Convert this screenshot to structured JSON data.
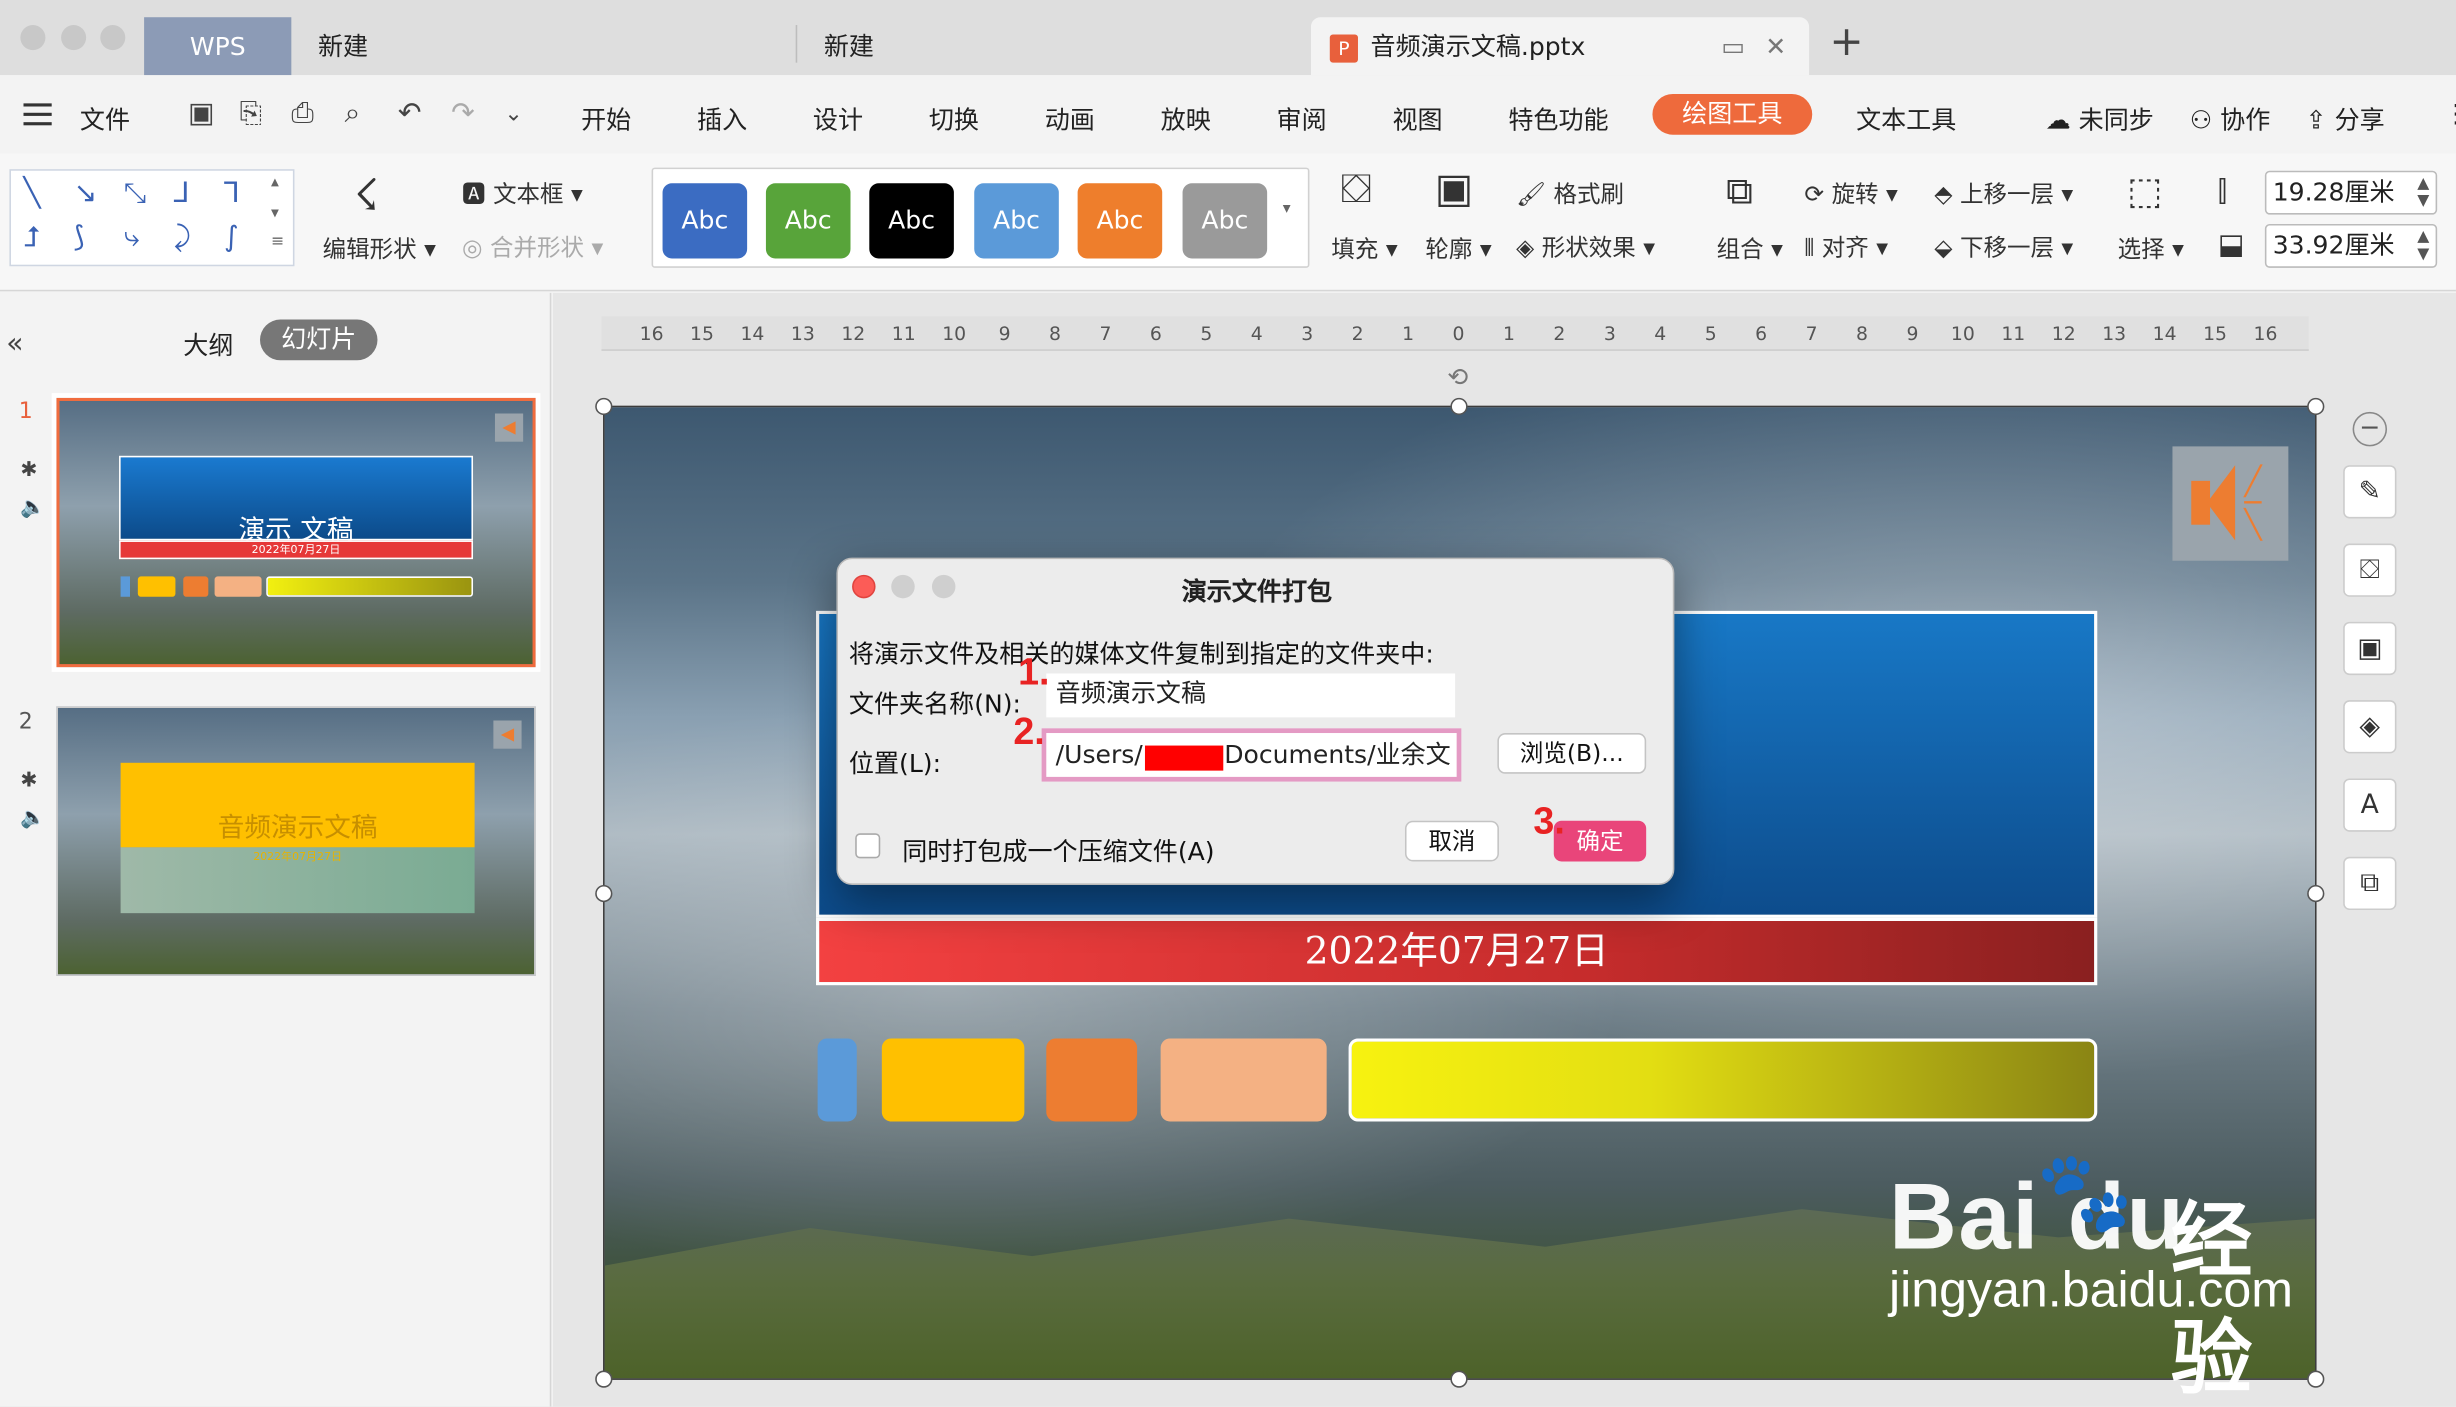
{
  "window": {
    "tabs": [
      {
        "label": "WPS"
      },
      {
        "label": "新建"
      },
      {
        "label": "新建"
      },
      {
        "label": "音频演示文稿.pptx"
      }
    ],
    "add_tab": "+"
  },
  "menu": {
    "file": "文件",
    "items": [
      "开始",
      "插入",
      "设计",
      "切换",
      "动画",
      "放映",
      "审阅",
      "视图",
      "特色功能",
      "绘图工具",
      "文本工具"
    ],
    "active": "绘图工具",
    "right": {
      "sync": "未同步",
      "collab": "协作",
      "share": "分享"
    }
  },
  "ribbon": {
    "edit_shape": "编辑形状",
    "textbox": "文本框",
    "merge_shape": "合并形状",
    "style_buttons": [
      {
        "label": "Abc",
        "color": "#3b6cc2"
      },
      {
        "label": "Abc",
        "color": "#58a43a"
      },
      {
        "label": "Abc",
        "color": "#000000"
      },
      {
        "label": "Abc",
        "color": "#5b9ad9"
      },
      {
        "label": "Abc",
        "color": "#ee7e2c"
      },
      {
        "label": "Abc",
        "color": "#9a9a9a"
      }
    ],
    "fill": "填充",
    "outline": "轮廓",
    "format_painter": "格式刷",
    "shape_effect": "形状效果",
    "group": "组合",
    "rotate": "旋转",
    "align": "对齐",
    "bring_forward": "上移一层",
    "send_backward": "下移一层",
    "select": "选择",
    "height": "19.28厘米",
    "width": "33.92厘米"
  },
  "left_panel": {
    "tab_outline": "大纲",
    "tab_slides": "幻灯片",
    "slides": [
      {
        "number": "1",
        "title": "演示 文稿",
        "date": "2022年07月27日"
      },
      {
        "number": "2",
        "title": "音频演示文稿",
        "date": "2022年07月27日"
      }
    ]
  },
  "ruler": {
    "ticks": [
      "16",
      "15",
      "14",
      "13",
      "12",
      "11",
      "10",
      "9",
      "8",
      "7",
      "6",
      "5",
      "4",
      "3",
      "2",
      "1",
      "0",
      "1",
      "2",
      "3",
      "4",
      "5",
      "6",
      "7",
      "8",
      "9",
      "10",
      "11",
      "12",
      "13",
      "14",
      "15",
      "16"
    ]
  },
  "slide": {
    "date": "2022年07月27日",
    "shape_colors": [
      "#5b9ad9",
      "#ffc000",
      "#ed7d31",
      "#f4b183"
    ]
  },
  "dialog": {
    "title": "演示文件打包",
    "description": "将演示文件及相关的媒体文件复制到指定的文件夹中:",
    "folder_label": "文件夹名称(N):",
    "folder_value": "音频演示文稿",
    "location_label": "位置(L):",
    "location_prefix": "/Users/",
    "location_suffix": "Documents/业余文",
    "browse": "浏览(B)...",
    "zip_checkbox": "同时打包成一个压缩文件(A)",
    "cancel": "取消",
    "ok": "确定",
    "steps": [
      "1.",
      "2.",
      "3."
    ]
  },
  "watermark": {
    "brand": "Bai  du",
    "cn": "经验",
    "url": "jingyan.baidu.com"
  }
}
